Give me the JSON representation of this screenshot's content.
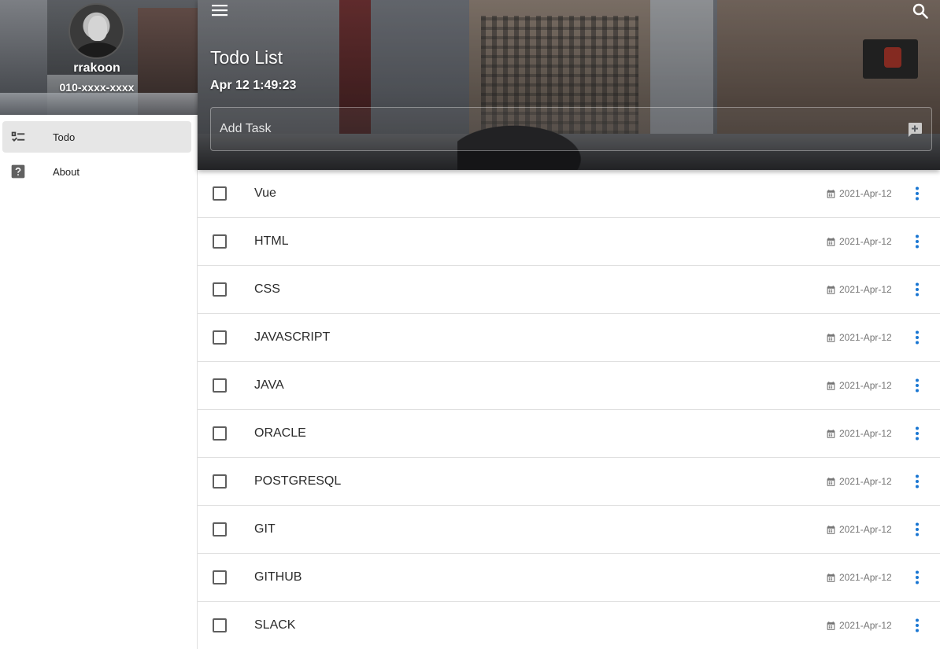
{
  "user": {
    "name": "rrakoon",
    "phone": "010-xxxx-xxxx"
  },
  "sidebar": {
    "items": [
      {
        "label": "Todo",
        "icon": "format-list-checks-icon",
        "active": true
      },
      {
        "label": "About",
        "icon": "help-box-icon",
        "active": false
      }
    ]
  },
  "header": {
    "title": "Todo List",
    "datetime": "Apr 12 1:49:23",
    "add_task": {
      "placeholder": "Add Task",
      "value": ""
    }
  },
  "tasks": [
    {
      "title": "Vue",
      "date": "2021-Apr-12",
      "done": false
    },
    {
      "title": "HTML",
      "date": "2021-Apr-12",
      "done": false
    },
    {
      "title": "CSS",
      "date": "2021-Apr-12",
      "done": false
    },
    {
      "title": "JAVASCRIPT",
      "date": "2021-Apr-12",
      "done": false
    },
    {
      "title": "JAVA",
      "date": "2021-Apr-12",
      "done": false
    },
    {
      "title": "ORACLE",
      "date": "2021-Apr-12",
      "done": false
    },
    {
      "title": "POSTGRESQL",
      "date": "2021-Apr-12",
      "done": false
    },
    {
      "title": "GIT",
      "date": "2021-Apr-12",
      "done": false
    },
    {
      "title": "GITHUB",
      "date": "2021-Apr-12",
      "done": false
    },
    {
      "title": "SLACK",
      "date": "2021-Apr-12",
      "done": false
    }
  ],
  "colors": {
    "accent": "#1976d2",
    "active_nav_bg": "#e6e6e6",
    "divider": "#e0e0e0"
  }
}
